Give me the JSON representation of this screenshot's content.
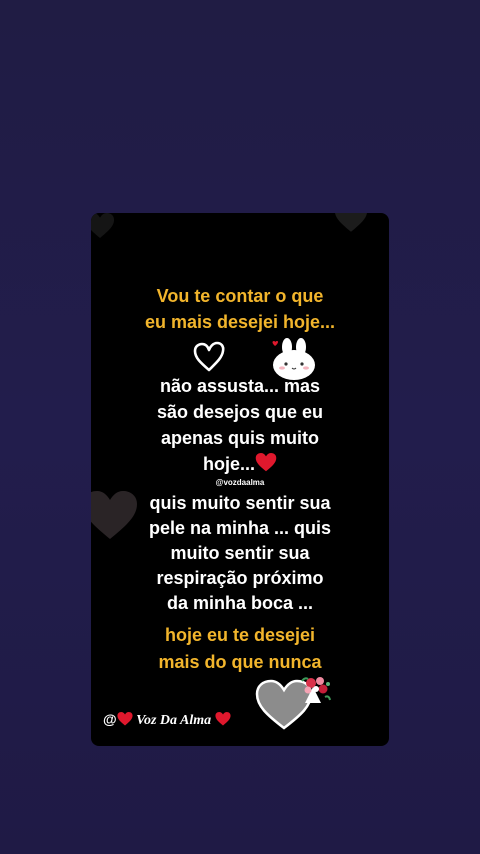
{
  "post": {
    "intro_line1": "Vou te contar o que",
    "intro_line2": "eu mais desejei hoje...",
    "body1_line1": "não assusta... mas",
    "body1_line2": "são desejos que eu",
    "body1_line3": "apenas quis muito",
    "body1_line4": "hoje...",
    "handle": "@vozdaalma",
    "body2_line1": "quis muito sentir sua",
    "body2_line2": "pele na minha ... quis",
    "body2_line3": "muito sentir sua",
    "body2_line4": "respiração  próximo",
    "body2_line5": "da minha boca ...",
    "closing_line1": "hoje eu te desejei",
    "closing_line2": "mais do que nunca"
  },
  "signature": {
    "at": "@",
    "name": "Voz Da Alma"
  },
  "colors": {
    "background": "#211c48",
    "card": "#000000",
    "accent_yellow": "#f2b52c",
    "heart_red": "#e0182d"
  },
  "icons": [
    "white-outline-heart-icon",
    "bunny-sticker-icon",
    "red-heart-icon",
    "gray-heart-icon",
    "flower-bouquet-icon"
  ]
}
